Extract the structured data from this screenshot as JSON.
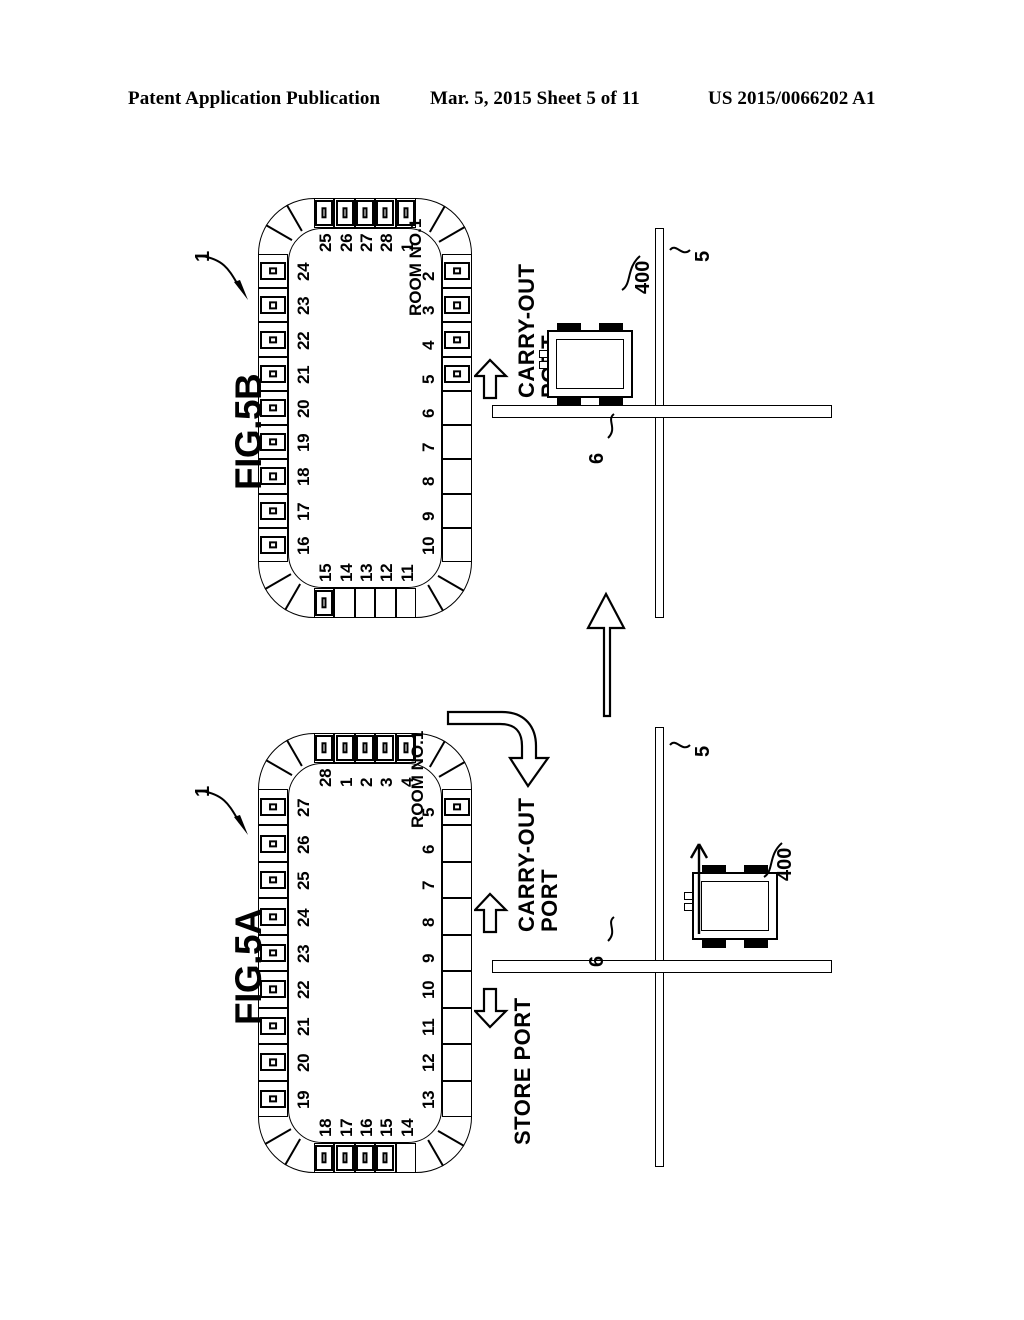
{
  "header": {
    "publication": "Patent Application Publication",
    "date_sheet": "Mar. 5, 2015   Sheet 5 of 11",
    "patent_number": "US 2015/0066202 A1"
  },
  "figures": [
    {
      "id": "fig5b",
      "label": "FIG.5B",
      "ring_ref": "1",
      "room_label": "ROOM NO.1",
      "cell_count": 28,
      "occupied_cells": [
        1,
        2,
        3,
        4,
        5,
        15,
        16,
        17,
        18,
        19,
        20,
        21,
        22,
        23,
        24,
        25,
        26,
        27,
        28
      ],
      "empty_cells": [
        6,
        7,
        8,
        9,
        10,
        11,
        12,
        13,
        14
      ],
      "cell_numbers": [
        1,
        2,
        3,
        4,
        5,
        6,
        7,
        8,
        9,
        10,
        11,
        12,
        13,
        14,
        15,
        16,
        17,
        18,
        19,
        20,
        21,
        22,
        23,
        24,
        25,
        26,
        27,
        28
      ],
      "ports": [
        {
          "name": "carry-out-port",
          "label": "CARRY-OUT\nPORT",
          "arrow": "right"
        }
      ],
      "rails": [
        {
          "ref": "5",
          "orientation": "vertical"
        },
        {
          "ref": "6",
          "orientation": "horizontal"
        }
      ],
      "vehicle": {
        "ref": "400"
      }
    },
    {
      "id": "fig5a",
      "label": "FIG.5A",
      "ring_ref": "1",
      "room_label": "ROOM NO.1",
      "cell_count": 28,
      "occupied_cells": [
        1,
        2,
        3,
        4,
        5,
        15,
        16,
        17,
        18,
        19,
        20,
        21,
        22,
        23,
        24,
        25,
        26,
        27,
        28
      ],
      "empty_cells": [
        6,
        7,
        8,
        9,
        10,
        11,
        12,
        13,
        14
      ],
      "cell_numbers": [
        1,
        2,
        3,
        4,
        5,
        6,
        7,
        8,
        9,
        10,
        11,
        12,
        13,
        14,
        15,
        16,
        17,
        18,
        19,
        20,
        21,
        22,
        23,
        24,
        25,
        26,
        27,
        28
      ],
      "ports": [
        {
          "name": "carry-out-port",
          "label": "CARRY-OUT\nPORT",
          "arrow": "right"
        },
        {
          "name": "store-port",
          "label": "STORE PORT",
          "arrow": "left"
        }
      ],
      "rails": [
        {
          "ref": "5",
          "orientation": "vertical"
        },
        {
          "ref": "6",
          "orientation": "horizontal"
        }
      ],
      "vehicle": {
        "ref": "400"
      }
    }
  ],
  "flow_arrow": {
    "name": "sequence-arrow",
    "direction": "up"
  },
  "rotation_arrow": {
    "name": "rotation-arrow",
    "direction": "curved-down"
  },
  "labels": {
    "fig5a_label": "FIG.5A",
    "fig5b_label": "FIG.5B",
    "ring_ref": "1",
    "room_no": "ROOM NO.1",
    "carry_out_line1": "CARRY-OUT",
    "carry_out_line2": "PORT",
    "store_port": "STORE PORT",
    "rail5": "5",
    "rail6": "6",
    "vehicle": "400"
  },
  "colors": {
    "ink": "#000000",
    "paper": "#ffffff"
  }
}
